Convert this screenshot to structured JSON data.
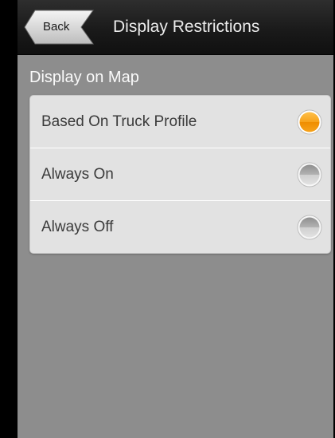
{
  "header": {
    "back_label": "Back",
    "title": "Display Restrictions"
  },
  "section": {
    "title": "Display on Map"
  },
  "options": [
    {
      "label": "Based On Truck Profile",
      "selected": true
    },
    {
      "label": "Always On",
      "selected": false
    },
    {
      "label": "Always Off",
      "selected": false
    }
  ],
  "colors": {
    "accent": "#f39a0c",
    "background": "#8d8d8d",
    "header": "#1a1a1a"
  }
}
